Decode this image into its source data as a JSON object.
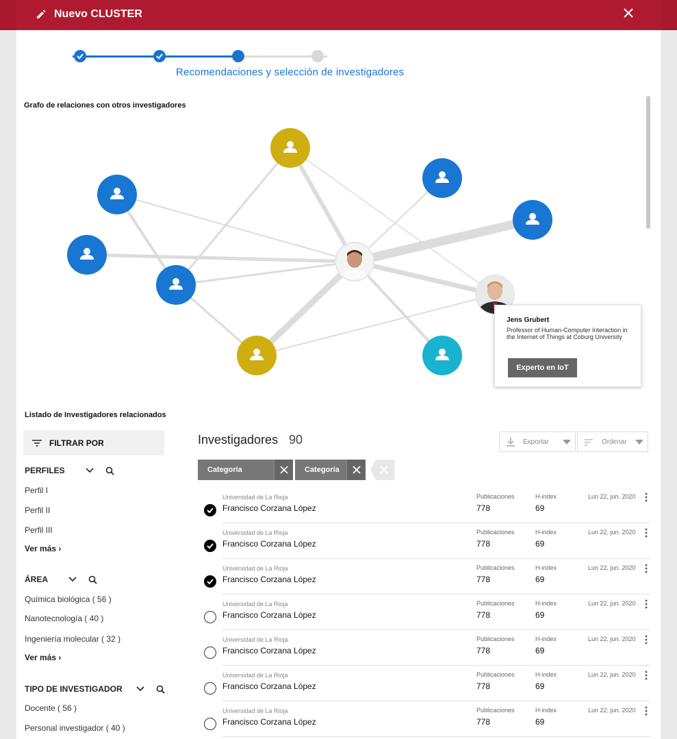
{
  "header": {
    "title": "Nuevo CLUSTER",
    "brand_color": "#b01a30"
  },
  "stepper": {
    "active_label": "Recomendaciones y selección de investigadores",
    "accent": "#1a73d1"
  },
  "graph": {
    "title": "Grafo de relaciones con otros investigadores",
    "tooltip": {
      "name": "Jens Grubert",
      "description": "Professor of Human-Computer Interaction in the Internet of Things at Coburg University",
      "button_label": "Experto en IoT"
    }
  },
  "list": {
    "title": "Listado de Investigadores relacionados"
  },
  "filters": {
    "label": "FILTRAR POR",
    "more_label": "Ver más",
    "perfiles": {
      "title": "PERFILES",
      "options": [
        "Perfil I",
        "Perfil II",
        "Perfil III"
      ]
    },
    "area": {
      "title": "ÁREA",
      "options": [
        "Química biológica ( 56 )",
        "Nanotecnología ( 40 )",
        "Ingeniería molecular ( 32 )"
      ]
    },
    "tipo": {
      "title": "TIPO DE INVESTIGADOR",
      "options": [
        "Docente ( 56 )",
        "Personal investigador ( 40 )"
      ]
    }
  },
  "results": {
    "title": "Investigadores",
    "count": "90",
    "export_label": "Exportar",
    "sort_label": "Ordenar",
    "chips": [
      "Categoría",
      "Categoría"
    ],
    "columns": {
      "pubs": "Publicaciones",
      "hindex": "H-index"
    },
    "rows": [
      {
        "uni": "Universidad de La Rioja",
        "name": "Francisco Corzana López",
        "pubs": "778",
        "hindex": "69",
        "date": "Lun 22, jun. 2020",
        "checked": true
      },
      {
        "uni": "Universidad de La Rioja",
        "name": "Francisco Corzana López",
        "pubs": "778",
        "hindex": "69",
        "date": "Lun 22, jun. 2020",
        "checked": true
      },
      {
        "uni": "Universidad de La Rioja",
        "name": "Francisco Corzana López",
        "pubs": "778",
        "hindex": "69",
        "date": "Lun 22, jun. 2020",
        "checked": true
      },
      {
        "uni": "Universidad de La Rioja",
        "name": "Francisco Corzana López",
        "pubs": "778",
        "hindex": "69",
        "date": "Lun 22, jun. 2020",
        "checked": false
      },
      {
        "uni": "Universidad de La Rioja",
        "name": "Francisco Corzana López",
        "pubs": "778",
        "hindex": "69",
        "date": "Lun 22, jun. 2020",
        "checked": false
      },
      {
        "uni": "Universidad de La Rioja",
        "name": "Francisco Corzana López",
        "pubs": "778",
        "hindex": "69",
        "date": "Lun 22, jun. 2020",
        "checked": false
      },
      {
        "uni": "Universidad de La Rioja",
        "name": "Francisco Corzana López",
        "pubs": "778",
        "hindex": "69",
        "date": "Lun 22, jun. 2020",
        "checked": false
      }
    ]
  }
}
